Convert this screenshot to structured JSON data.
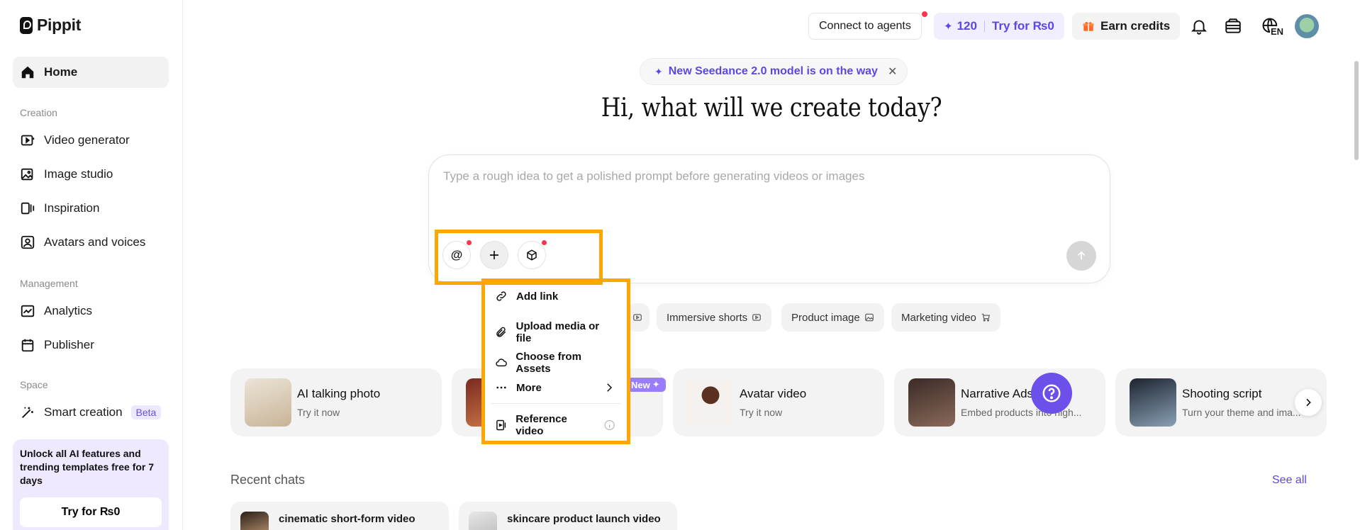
{
  "app": {
    "name": "Pippit"
  },
  "sidebar": {
    "home": "Home",
    "sections": {
      "creation": "Creation",
      "management": "Management",
      "space": "Space"
    },
    "items": [
      {
        "label": "Video generator"
      },
      {
        "label": "Image studio"
      },
      {
        "label": "Inspiration"
      },
      {
        "label": "Avatars and voices"
      },
      {
        "label": "Analytics"
      },
      {
        "label": "Publisher"
      },
      {
        "label": "Smart creation",
        "badge": "Beta"
      }
    ],
    "promo": {
      "text": "Unlock all AI features and trending templates free for 7 days",
      "button": "Try for ₨0"
    }
  },
  "header": {
    "connect_agents": "Connect to agents",
    "credits": "120",
    "try_label": "Try for ₨0",
    "earn_credits": "Earn credits",
    "language": "EN"
  },
  "hero": {
    "announcement": "New Seedance 2.0 model is on the way",
    "headline": "Hi, what will we create today?"
  },
  "prompt": {
    "placeholder": "Type a rough idea to get a polished prompt before generating videos or images"
  },
  "chips": [
    {
      "label": "Immersive shorts"
    },
    {
      "label": "Product image"
    },
    {
      "label": "Marketing video"
    }
  ],
  "menu": {
    "items": [
      {
        "label": "Add link"
      },
      {
        "label": "Upload media or file"
      },
      {
        "label": "Choose from Assets"
      },
      {
        "label": "More"
      },
      {
        "label": "Reference video"
      }
    ]
  },
  "cards": [
    {
      "title": "AI talking photo",
      "subtitle": "Try it now"
    },
    {
      "title": "",
      "subtitle": "",
      "badge": "New"
    },
    {
      "title": "Avatar video",
      "subtitle": "Try it now"
    },
    {
      "title": "Narrative Ads",
      "subtitle": "Embed products into high..."
    },
    {
      "title": "Shooting script",
      "subtitle": "Turn your theme and ima..."
    }
  ],
  "recent": {
    "title": "Recent chats",
    "see_all": "See all",
    "chats": [
      {
        "title": "cinematic short-form video"
      },
      {
        "title": "skincare product launch video"
      }
    ]
  },
  "colors": {
    "accent": "#5a48e6",
    "highlight": "#ffa600",
    "help": "#6d4fea",
    "notification": "#f5364c"
  }
}
